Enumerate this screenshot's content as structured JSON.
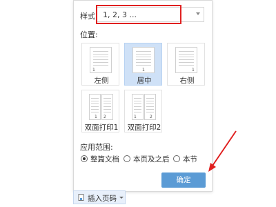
{
  "style": {
    "label": "样式:",
    "value": "1, 2, 3 ..."
  },
  "position": {
    "label": "位置:",
    "options": [
      {
        "label": "左侧",
        "num": "1"
      },
      {
        "label": "居中",
        "num": "1",
        "selected": true
      },
      {
        "label": "右侧",
        "num": "1"
      },
      {
        "label": "双面打印1",
        "nums": [
          "1",
          "2"
        ]
      },
      {
        "label": "双面打印2",
        "nums": [
          "1",
          "2"
        ]
      }
    ]
  },
  "scope": {
    "label": "应用范围:",
    "options": [
      "整篇文档",
      "本页及之后",
      "本节"
    ],
    "selected": "整篇文档"
  },
  "ok_button": "确定",
  "taskbar": {
    "label": "插入页码"
  },
  "colors": {
    "accent": "#5b9bd5",
    "selected_tile": "#cfe1f7",
    "highlight": "#e02020"
  }
}
